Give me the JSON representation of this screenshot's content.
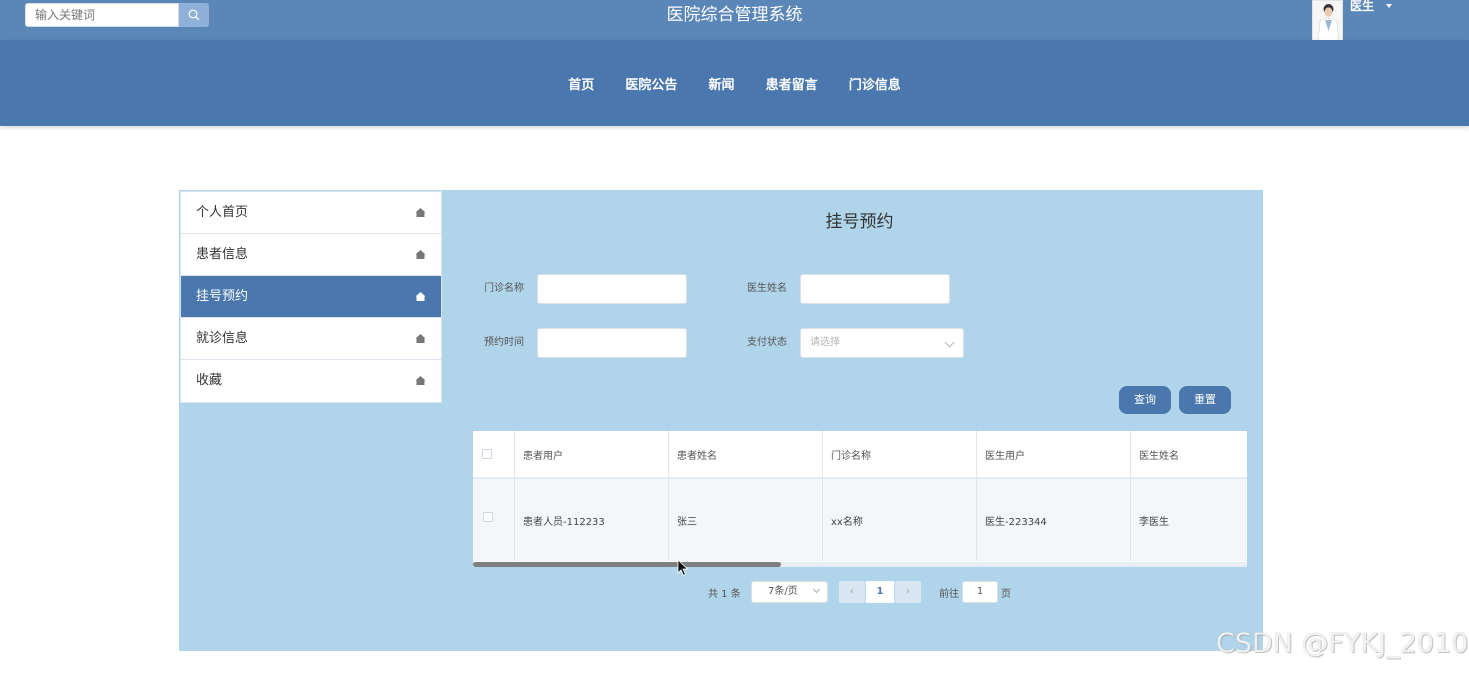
{
  "header": {
    "search_placeholder": "输入关键词",
    "site_title": "医院综合管理系统",
    "user_name": "医生"
  },
  "menu": [
    "首页",
    "医院公告",
    "新闻",
    "患者留言",
    "门诊信息"
  ],
  "sidebar": {
    "items": [
      {
        "label": "个人首页",
        "active": false
      },
      {
        "label": "患者信息",
        "active": false
      },
      {
        "label": "挂号预约",
        "active": true
      },
      {
        "label": "就诊信息",
        "active": false
      },
      {
        "label": "收藏",
        "active": false
      }
    ]
  },
  "page": {
    "heading": "挂号预约"
  },
  "filters": {
    "clinic_label": "门诊名称",
    "clinic_value": "",
    "doctor_label": "医生姓名",
    "doctor_value": "",
    "time_label": "预约时间",
    "time_value": "",
    "pay_label": "支付状态",
    "pay_placeholder": "请选择",
    "query_button": "查询",
    "reset_button": "重置"
  },
  "table": {
    "columns": [
      "患者用户",
      "患者姓名",
      "门诊名称",
      "医生用户",
      "医生姓名"
    ],
    "rows": [
      [
        "患者人员-112233",
        "张三",
        "xx名称",
        "医生-223344",
        "李医生"
      ]
    ]
  },
  "pagination": {
    "total": "共 1 条",
    "page_size": "7条/页",
    "prev": "‹",
    "current": "1",
    "next": "›",
    "goto_label": "前往",
    "goto_value": "1",
    "page_suffix": "页"
  },
  "watermark": "CSDN @FYKJ_2010",
  "colors": {
    "topbar": "#5b86b8",
    "nav": "#4a78ae",
    "panel": "#b0d4ea",
    "active": "#4a78ae"
  }
}
